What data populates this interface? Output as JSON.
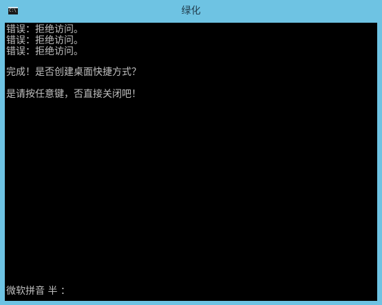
{
  "window": {
    "title": "绿化",
    "icon_text": "C:\\"
  },
  "console": {
    "lines": [
      "错误：拒绝访问。",
      "错误：拒绝访问。",
      "错误：拒绝访问。",
      "完成！是否创建桌面快捷方式？",
      "是请按任意键，否直接关闭吧！"
    ],
    "ime_status": "微软拼音 半 ："
  },
  "colors": {
    "frame": "#6ec3e3",
    "console_bg": "#000000",
    "console_text": "#c0c0c0"
  }
}
